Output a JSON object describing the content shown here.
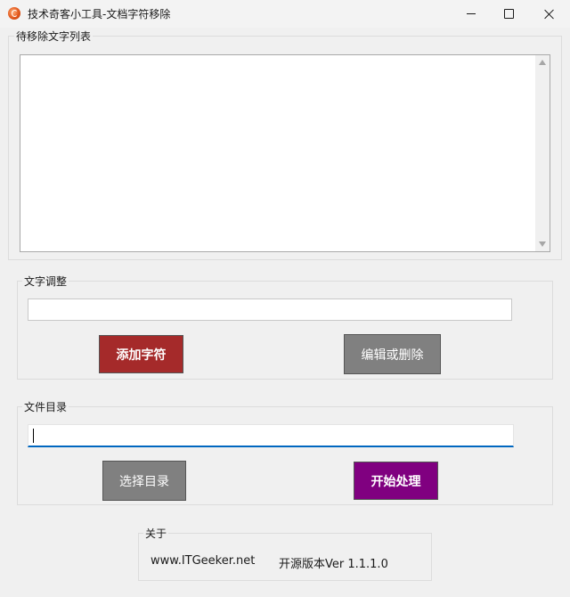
{
  "window": {
    "title": "技术奇客小工具-文档字符移除",
    "icon": "app-icon"
  },
  "list_group": {
    "label": "待移除文字列表",
    "items": []
  },
  "text_adjust": {
    "label": "文字调整",
    "input_value": "",
    "add_button": "添加字符",
    "edit_button": "编辑或删除"
  },
  "file_dir": {
    "label": "文件目录",
    "input_value": "",
    "select_button": "选择目录",
    "start_button": "开始处理"
  },
  "about": {
    "label": "关于",
    "website": "www.ITGeeker.net",
    "version": "开源版本Ver 1.1.1.0"
  },
  "colors": {
    "add_button_bg": "#a52a2a",
    "gray_button_bg": "#808080",
    "start_button_bg": "#800080",
    "focus_accent": "#0067c0"
  }
}
